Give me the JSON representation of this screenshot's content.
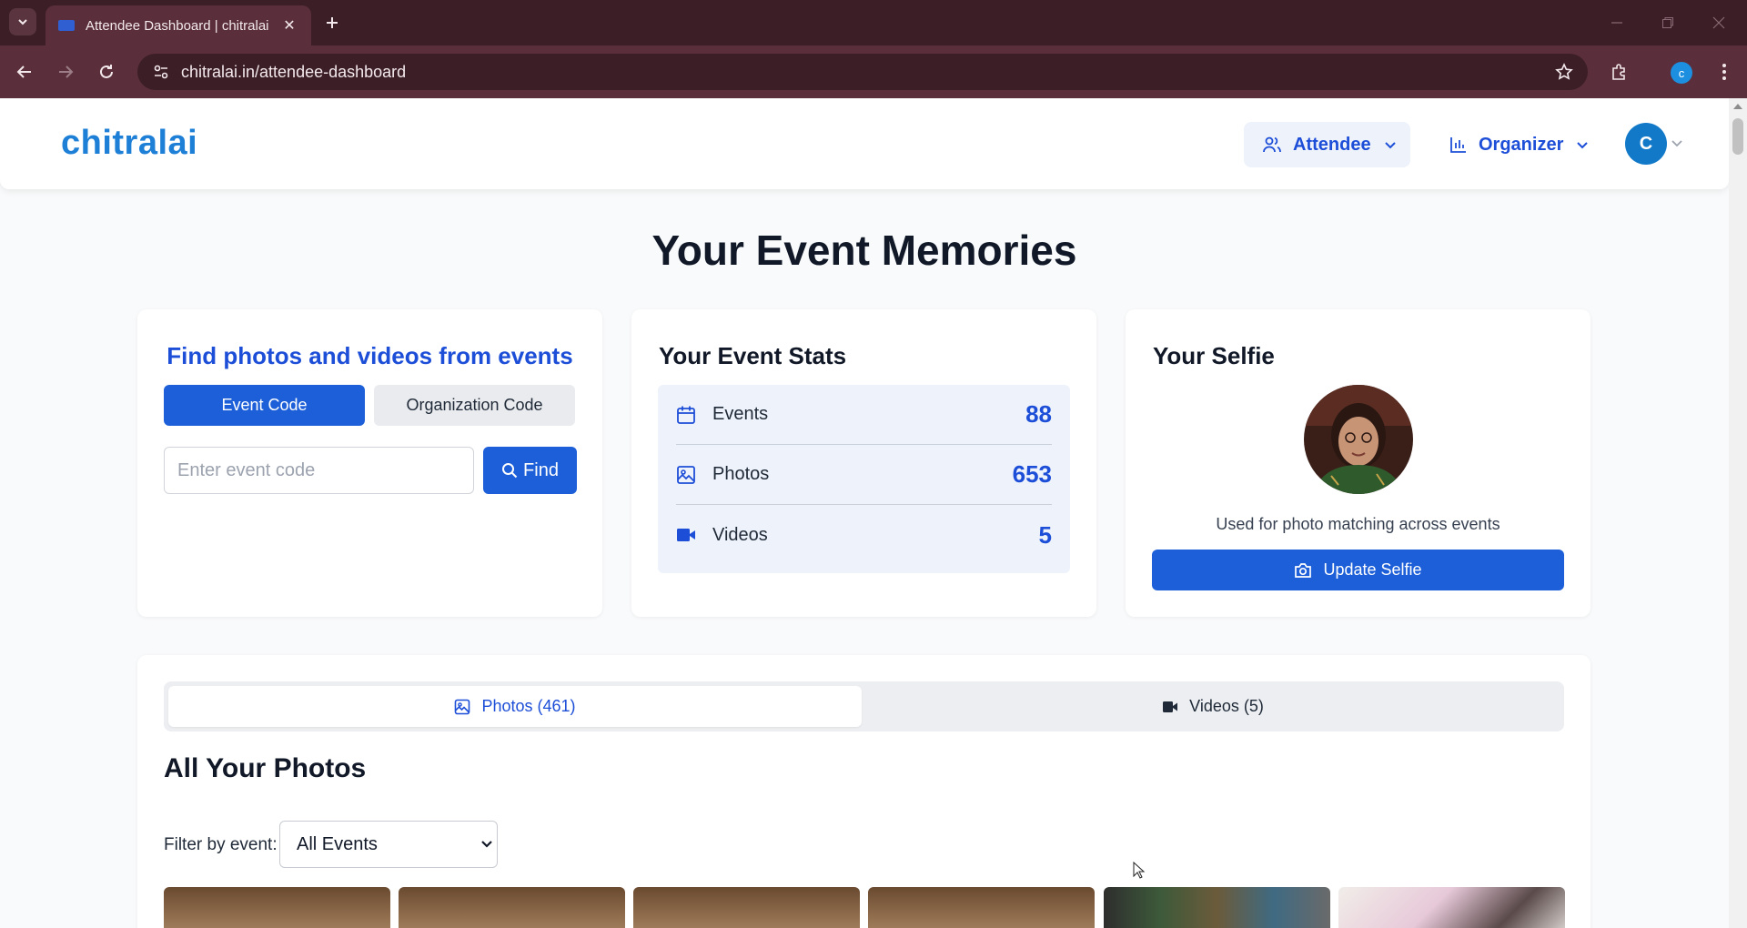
{
  "browser": {
    "tab_title": "Attendee Dashboard | chitralai",
    "url": "chitralai.in/attendee-dashboard",
    "profile_initial": "c"
  },
  "header": {
    "logo": "chitralai",
    "attendee_label": "Attendee",
    "organizer_label": "Organizer",
    "user_initial": "C"
  },
  "page_title": "Your Event Memories",
  "find": {
    "title": "Find photos and videos from events",
    "tab_event_code": "Event Code",
    "tab_org_code": "Organization Code",
    "placeholder": "Enter event code",
    "find_label": "Find"
  },
  "stats": {
    "title": "Your Event Stats",
    "rows": [
      {
        "label": "Events",
        "value": "88",
        "icon": "calendar-icon"
      },
      {
        "label": "Photos",
        "value": "653",
        "icon": "image-icon"
      },
      {
        "label": "Videos",
        "value": "5",
        "icon": "video-icon"
      }
    ]
  },
  "selfie": {
    "title": "Your Selfie",
    "caption": "Used for photo matching across events",
    "update_label": "Update Selfie"
  },
  "gallery": {
    "tab_photos": "Photos (461)",
    "tab_videos": "Videos (5)",
    "section_title": "All Your Photos",
    "filter_label": "Filter by event:",
    "filter_value": "All Events"
  },
  "colors": {
    "primary": "#1d5fd8",
    "logo": "#1d7fd6",
    "chrome_dark": "#3c1e27",
    "chrome_tab": "#5a2f3b"
  }
}
